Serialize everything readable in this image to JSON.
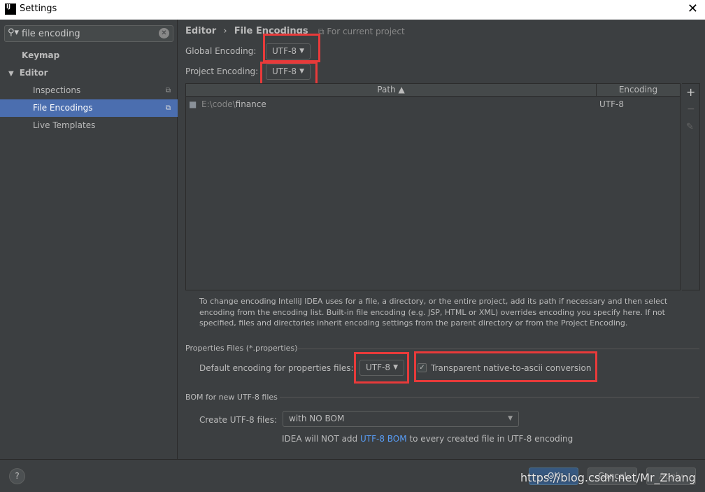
{
  "window": {
    "title": "Settings",
    "app_icon": "IJ"
  },
  "sidebar": {
    "search_value": "file encoding",
    "items": [
      {
        "label": "Keymap"
      },
      {
        "label": "Editor"
      },
      {
        "label": "Inspections"
      },
      {
        "label": "File Encodings"
      },
      {
        "label": "Live Templates"
      }
    ]
  },
  "breadcrumb": {
    "parent": "Editor",
    "separator": "›",
    "current": "File Encodings",
    "scope": "For current project"
  },
  "global_encoding": {
    "label": "Global Encoding:",
    "value": "UTF-8"
  },
  "project_encoding": {
    "label": "Project Encoding:",
    "value": "UTF-8"
  },
  "table": {
    "columns": [
      "Path ▲",
      "Encoding"
    ],
    "rows": [
      {
        "path_prefix": "E:\\code\\",
        "path_name": "finance",
        "encoding": "UTF-8"
      }
    ]
  },
  "table_tools": {
    "add": "+",
    "remove": "−",
    "edit": "✎"
  },
  "help_text": "To change encoding IntelliJ IDEA uses for a file, a directory, or the entire project, add its path if necessary and then select encoding from the encoding list. Built-in file encoding (e.g. JSP, HTML or XML) overrides encoding you specify here. If not specified, files and directories inherit encoding settings from the parent directory or from the Project Encoding.",
  "properties": {
    "group": "Properties Files (*.properties)",
    "label": "Default encoding for properties files:",
    "value": "UTF-8",
    "checkbox_label": "Transparent native-to-ascii conversion",
    "checked": true
  },
  "bom": {
    "group": "BOM for new UTF-8 files",
    "label": "Create UTF-8 files:",
    "value": "with NO BOM",
    "note_prefix": "IDEA will NOT add ",
    "note_link": "UTF-8 BOM",
    "note_suffix": " to every created file in UTF-8 encoding"
  },
  "footer": {
    "help": "?",
    "ok": "OK",
    "cancel": "Cancel",
    "apply": "Apply"
  },
  "watermark": "https://blog.csdn.net/Mr_Zhang",
  "colors": {
    "selection": "#4b6eaf",
    "link": "#589df6",
    "annotation": "#e83a3a",
    "ok_button": "#365880"
  }
}
